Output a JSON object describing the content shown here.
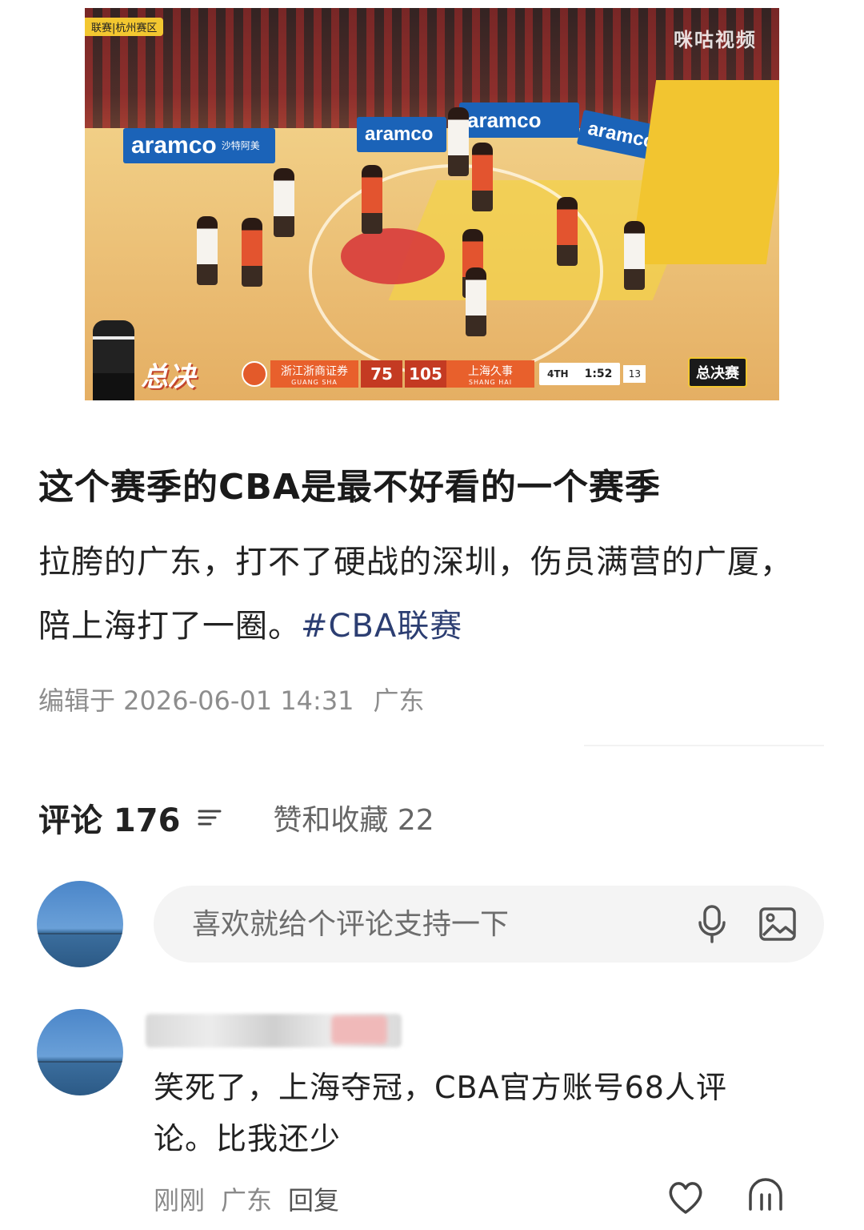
{
  "video": {
    "corner_tag": "联赛|杭州赛区",
    "watermark": "咪咕视频",
    "sponsor": "aramco",
    "sponsor_sub": "沙特阿美",
    "scoreboard": {
      "title": "总决",
      "home_team": "浙江浙商证券",
      "home_sub": "GUANG SHA",
      "home_score": "75",
      "away_score": "105",
      "away_team": "上海久事",
      "away_sub": "SHANG HAI",
      "quarter": "4TH",
      "clock": "1:52",
      "shot_clock": "13"
    },
    "finals_badge": "总决赛"
  },
  "post": {
    "title": "这个赛季的CBA是最不好看的一个赛季",
    "body": "拉胯的广东，打不了硬战的深圳，伤员满营的广厦，陪上海打了一圈。",
    "hashtag": "#CBA联赛",
    "meta_edited": "编辑于 2026-06-01 14:31",
    "meta_location": "广东"
  },
  "tabs": {
    "comments": "评论 176",
    "likes": "赞和收藏 22"
  },
  "comment_input": {
    "placeholder": "喜欢就给个评论支持一下"
  },
  "comment": {
    "text": "笑死了，上海夺冠，CBA官方账号68人评论。比我还少",
    "time": "刚刚",
    "location": "广东",
    "reply": "回复"
  },
  "icons": {
    "sort": "sort-icon",
    "mic": "mic-icon",
    "image": "image-icon",
    "like": "heart-icon",
    "more": "comment-bubble-icon"
  }
}
